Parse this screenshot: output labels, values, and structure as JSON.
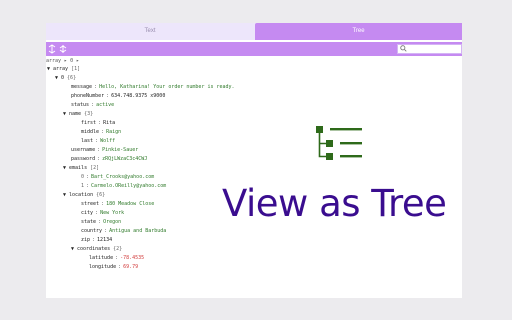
{
  "tabs": {
    "text_label": "Text",
    "tree_label": "Tree"
  },
  "toolbar": {
    "collapse_icon": "collapse-icon",
    "expand_icon": "expand-icon",
    "search_icon": "search-icon"
  },
  "breadcrumb": "array ▸ 0 ▸",
  "tree": {
    "root_key": "array",
    "root_count": "[1]",
    "item0_key": "0",
    "item0_count": "{6}",
    "message_key": "message",
    "message_val": "Hello, Katharina! Your order number is ready.",
    "phone_key": "phoneNumber",
    "phone_val": "634.748.9375 x9000",
    "status_key": "status",
    "status_val": "active",
    "name_key": "name",
    "name_count": "{3}",
    "first_key": "first",
    "first_val": "Rita",
    "middle_key": "middle",
    "middle_val": "Raign",
    "last_key": "last",
    "last_val": "Wolff",
    "username_key": "username",
    "username_val": "Pinkie-Sauer",
    "password_key": "password",
    "password_val": "zRQjLWzaC3c4CWJ",
    "emails_key": "emails",
    "emails_count": "[2]",
    "email0_key": "0",
    "email0_val": "Bart_Crooks@yahoo.com",
    "email1_key": "1",
    "email1_val": "Carmelo.OReilly@yahoo.com",
    "location_key": "location",
    "location_count": "{6}",
    "street_key": "street",
    "street_val": "180 Meadow Close",
    "city_key": "city",
    "city_val": "New York",
    "state_key": "state",
    "state_val": "Oregon",
    "country_key": "country",
    "country_val": "Antigua and Barbuda",
    "zip_key": "zip",
    "zip_val": "12134",
    "coords_key": "coordinates",
    "coords_count": "{2}",
    "lat_key": "latitude",
    "lat_val": "-78.4535",
    "lng_key": "longitude",
    "lng_val": "69.79"
  },
  "banner": {
    "title": "View as Tree",
    "color": "#3a0d8f"
  },
  "logo": {
    "icon": "tree-structure-icon",
    "color": "#2e6a1a"
  }
}
